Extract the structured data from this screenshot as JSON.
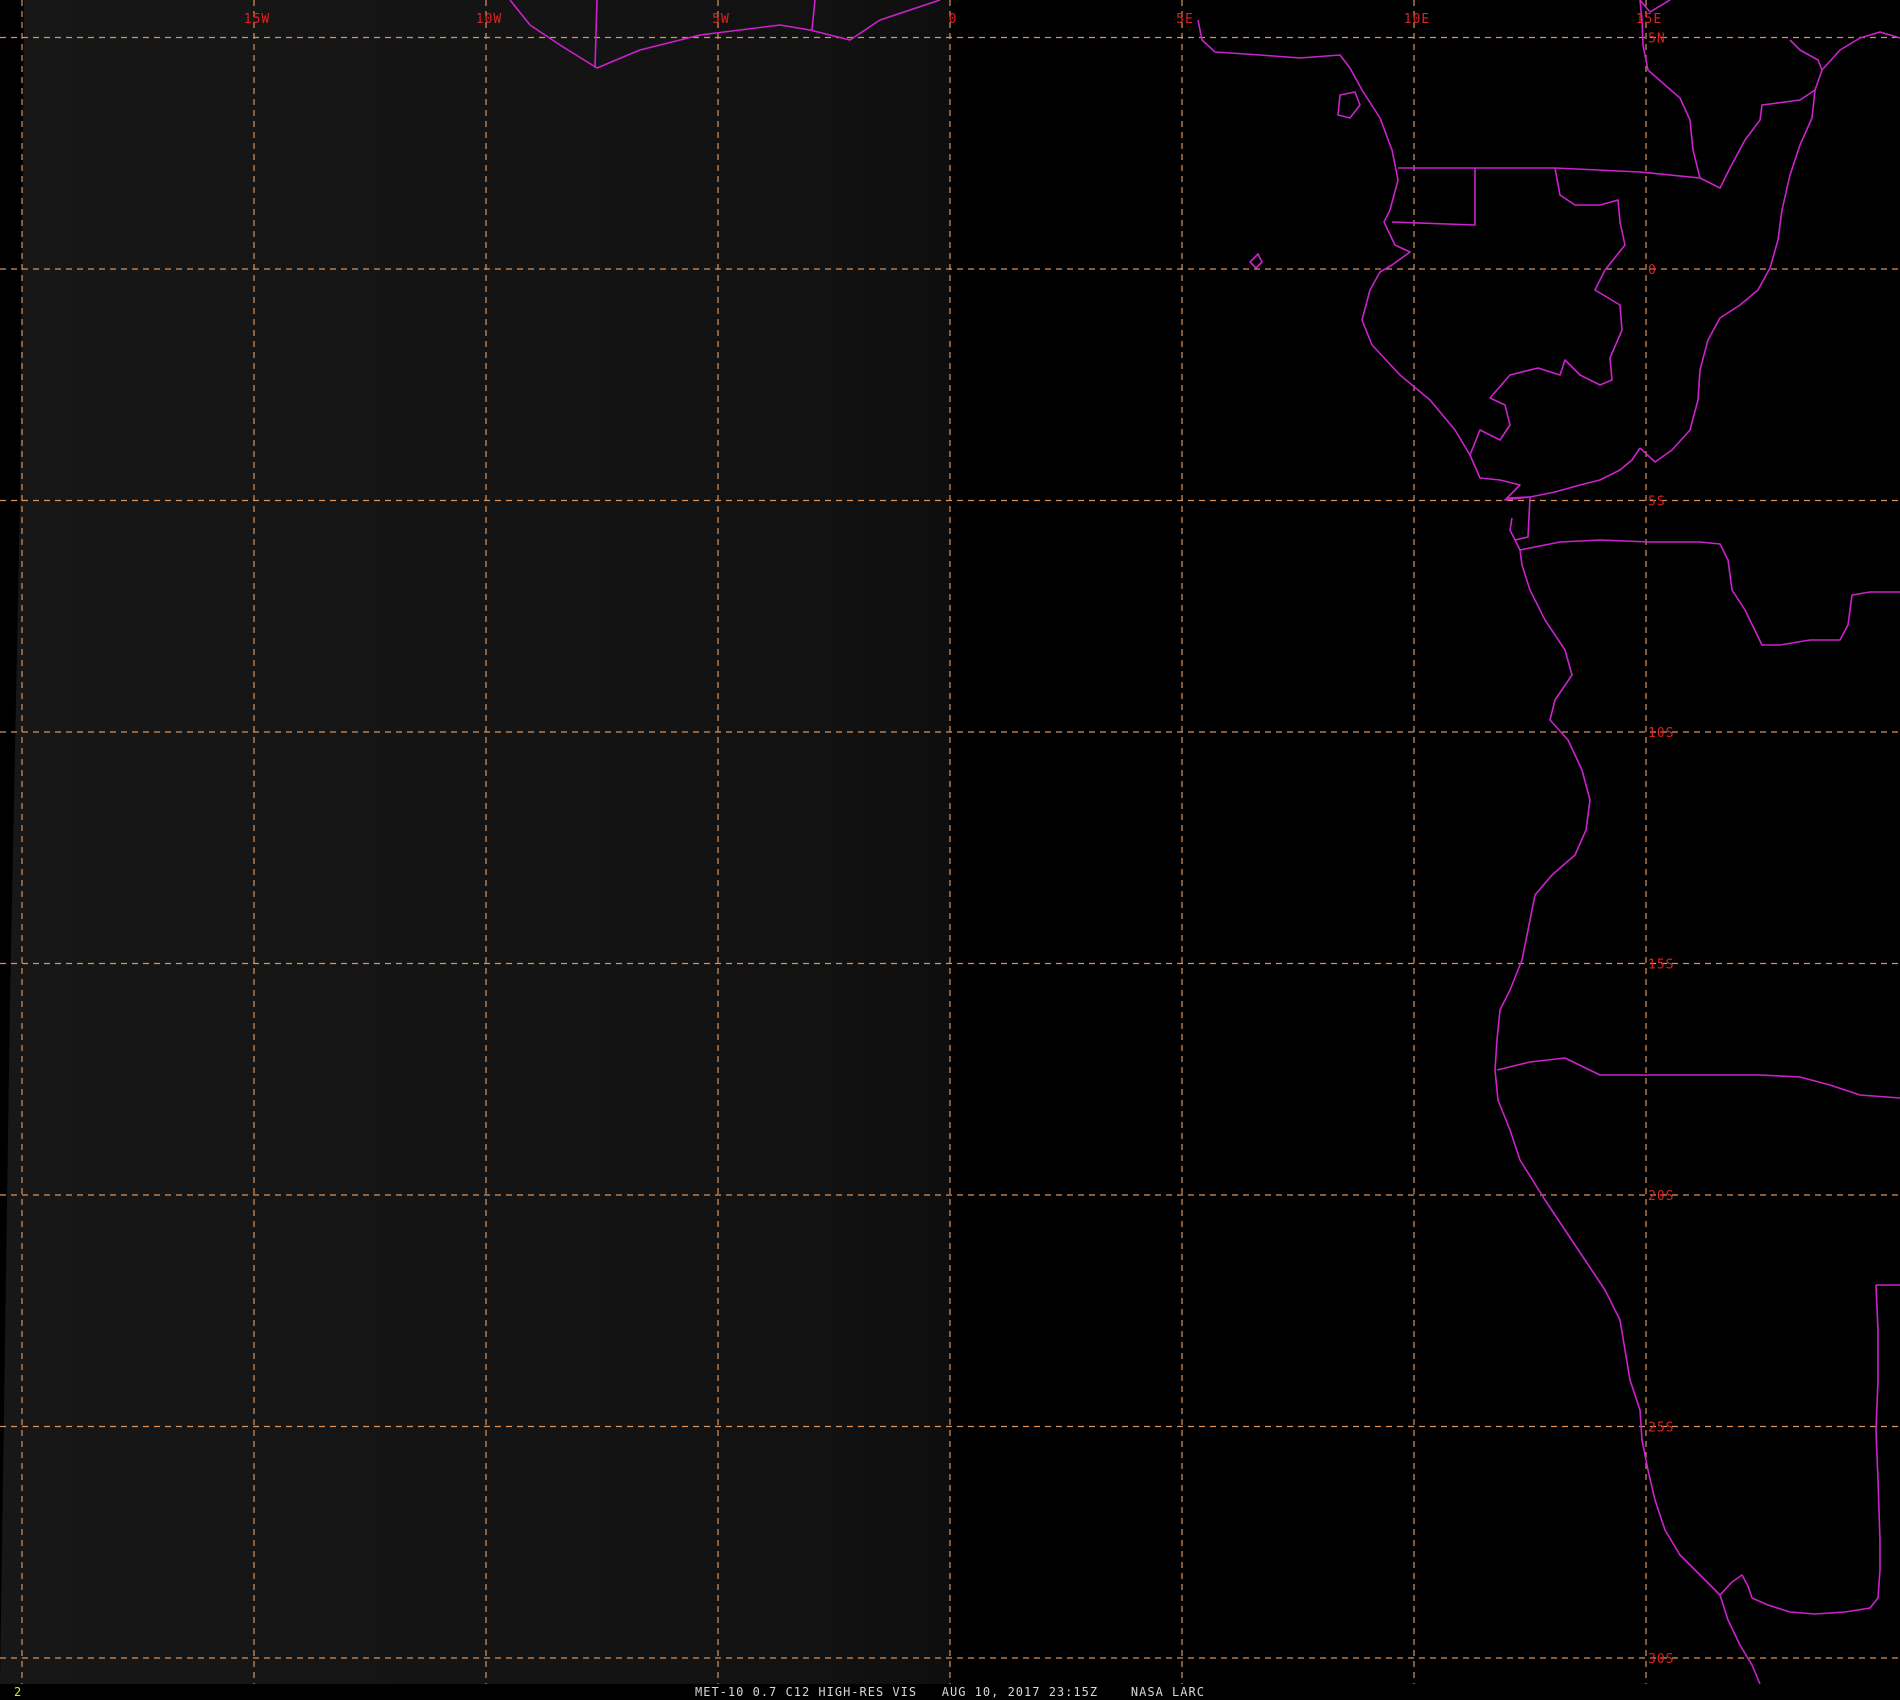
{
  "colors": {
    "background": "#000000",
    "disk_haze": "#141414",
    "grid": "#d9925a",
    "coastline": "#cc22cc",
    "coord_label": "#dd2222",
    "frame_number": "#e6e600",
    "caption": "#d8d8d8"
  },
  "map": {
    "projection": "satellite-view",
    "longitude_range": [
      -20,
      20
    ],
    "latitude_range": [
      -30,
      5
    ],
    "longitude_labels": [
      {
        "lon": -15,
        "text": "15W"
      },
      {
        "lon": -10,
        "text": "10W"
      },
      {
        "lon": -5,
        "text": "5W"
      },
      {
        "lon": 0,
        "text": "0"
      },
      {
        "lon": 5,
        "text": "5E"
      },
      {
        "lon": 10,
        "text": "10E"
      },
      {
        "lon": 15,
        "text": "15E"
      }
    ],
    "latitude_labels": [
      {
        "lat": 5,
        "text": "5N"
      },
      {
        "lat": 0,
        "text": "0"
      },
      {
        "lat": -5,
        "text": "5S"
      },
      {
        "lat": -10,
        "text": "10S"
      },
      {
        "lat": -15,
        "text": "15S"
      },
      {
        "lat": -20,
        "text": "20S"
      },
      {
        "lat": -25,
        "text": "25S"
      },
      {
        "lat": -30,
        "text": "30S"
      }
    ]
  },
  "status": {
    "frame_number": "2",
    "caption": "MET-10 0.7 C12 HIGH-RES VIS   AUG 10, 2017 23:15Z    NASA LARC"
  }
}
